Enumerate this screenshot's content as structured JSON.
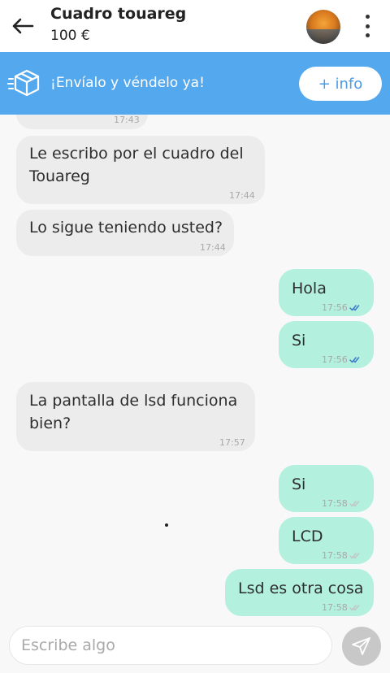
{
  "header": {
    "title": "Cuadro touareg",
    "price": "100 €"
  },
  "banner": {
    "text": "¡Envíalo y véndelo ya!",
    "info_button": "+ info"
  },
  "messages": [
    {
      "direction": "in",
      "text": "",
      "time": "17:43"
    },
    {
      "direction": "in",
      "text_lines": [
        "Le escribo por el cuadro del",
        "Touareg"
      ],
      "time": "17:44"
    },
    {
      "direction": "in",
      "text": "Lo sigue teniendo usted?",
      "time": "17:44"
    },
    {
      "direction": "out",
      "text": "Hola",
      "time": "17:56",
      "status": "read"
    },
    {
      "direction": "out",
      "text": "Si",
      "time": "17:56",
      "status": "read"
    },
    {
      "direction": "in",
      "text_lines": [
        "La pantalla de lsd funciona",
        "bien?"
      ],
      "time": "17:57"
    },
    {
      "direction": "out",
      "text": "Si",
      "time": "17:58",
      "status": "delivered"
    },
    {
      "direction": "out",
      "text": "LCD",
      "time": "17:58",
      "status": "delivered"
    },
    {
      "direction": "out",
      "text": "Lsd es otra cosa",
      "time": "17:58",
      "status": "delivered"
    }
  ],
  "composer": {
    "placeholder": "Escribe algo"
  },
  "colors": {
    "banner": "#53a8ee",
    "incoming_bubble": "#ececec",
    "outgoing_bubble": "#b3f0de",
    "read_ticks": "#3b78c9",
    "delivered_ticks": "#c4c4c4"
  },
  "icons": {
    "back": "arrow-left-icon",
    "menu": "more-vertical-icon",
    "banner": "package-box-icon",
    "read": "double-check-icon",
    "send": "send-icon"
  }
}
